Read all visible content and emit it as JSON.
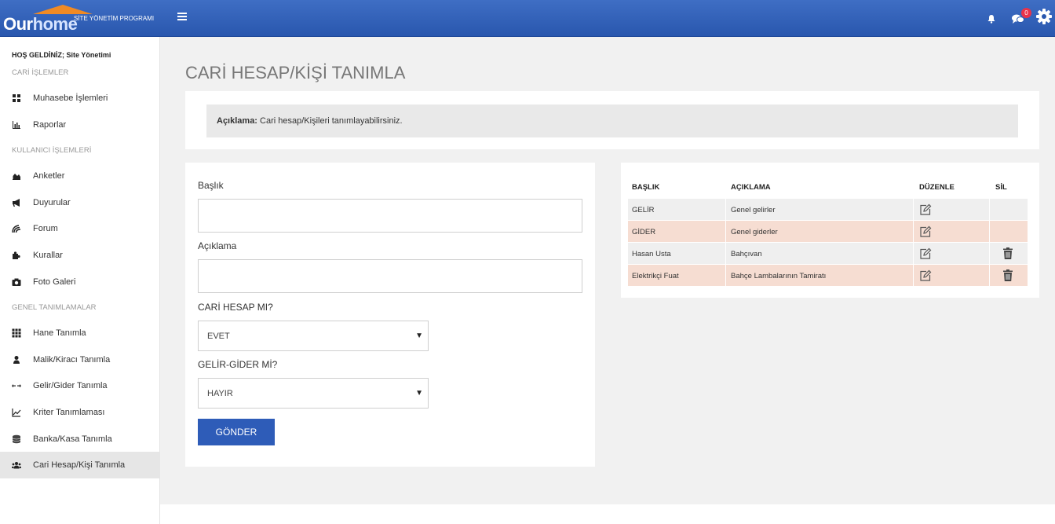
{
  "app": {
    "logo_our": "Our",
    "logo_home": "home",
    "logo_subtitle": "SİTE YÖNETİM PROGRAMI",
    "notification_count": "0"
  },
  "sidebar": {
    "welcome": "HOŞ GELDİNİZ; Site Yönetimi",
    "sections": [
      {
        "title": "CARİ İŞLEMLER"
      },
      {
        "title": "KULLANICI İŞLEMLERİ"
      },
      {
        "title": "GENEL TANIMLAMALAR"
      }
    ],
    "items": [
      {
        "label": "Muhasebe İşlemleri",
        "icon": "dashboard-icon"
      },
      {
        "label": "Raporlar",
        "icon": "bar-chart-icon"
      },
      {
        "label": "Anketler",
        "icon": "area-chart-icon"
      },
      {
        "label": "Duyurular",
        "icon": "megaphone-icon"
      },
      {
        "label": "Forum",
        "icon": "forum-icon"
      },
      {
        "label": "Kurallar",
        "icon": "puzzle-icon"
      },
      {
        "label": "Foto Galeri",
        "icon": "camera-icon"
      },
      {
        "label": "Hane Tanımla",
        "icon": "grid-icon"
      },
      {
        "label": "Malik/Kiracı Tanımla",
        "icon": "user-icon"
      },
      {
        "label": "Gelir/Gider Tanımla",
        "icon": "exchange-icon"
      },
      {
        "label": "Kriter Tanımlaması",
        "icon": "line-chart-icon"
      },
      {
        "label": "Banka/Kasa Tanımla",
        "icon": "database-icon"
      },
      {
        "label": "Cari Hesap/Kişi Tanımla",
        "icon": "users-icon"
      }
    ],
    "active_item": "Cari Hesap/Kişi Tanımla"
  },
  "main": {
    "title": "CARİ HESAP/KİŞİ TANIMLA",
    "description_label": "Açıklama:",
    "description_text": " Cari hesap/Kişileri tanımlayabilirsiniz."
  },
  "form": {
    "title_label": "Başlık",
    "title_value": "",
    "desc_label": "Açıklama",
    "desc_value": "",
    "cari_label": "CARİ HESAP MI?",
    "cari_value": "EVET",
    "gelir_label": "GELİR-GİDER Mİ?",
    "gelir_value": "HAYIR",
    "submit_label": "GÖNDER"
  },
  "table": {
    "headers": [
      "BAŞLIK",
      "AÇIKLAMA",
      "DÜZENLE",
      "SİL"
    ],
    "rows": [
      {
        "title": "GELİR",
        "desc": "Genel gelirler",
        "deletable": false
      },
      {
        "title": "GİDER",
        "desc": "Genel giderler",
        "deletable": false
      },
      {
        "title": "Hasan Usta",
        "desc": "Bahçıvan",
        "deletable": true
      },
      {
        "title": "Elektrikçi Fuat",
        "desc": "Bahçe Lambalarının Tamiratı",
        "deletable": true
      }
    ]
  }
}
